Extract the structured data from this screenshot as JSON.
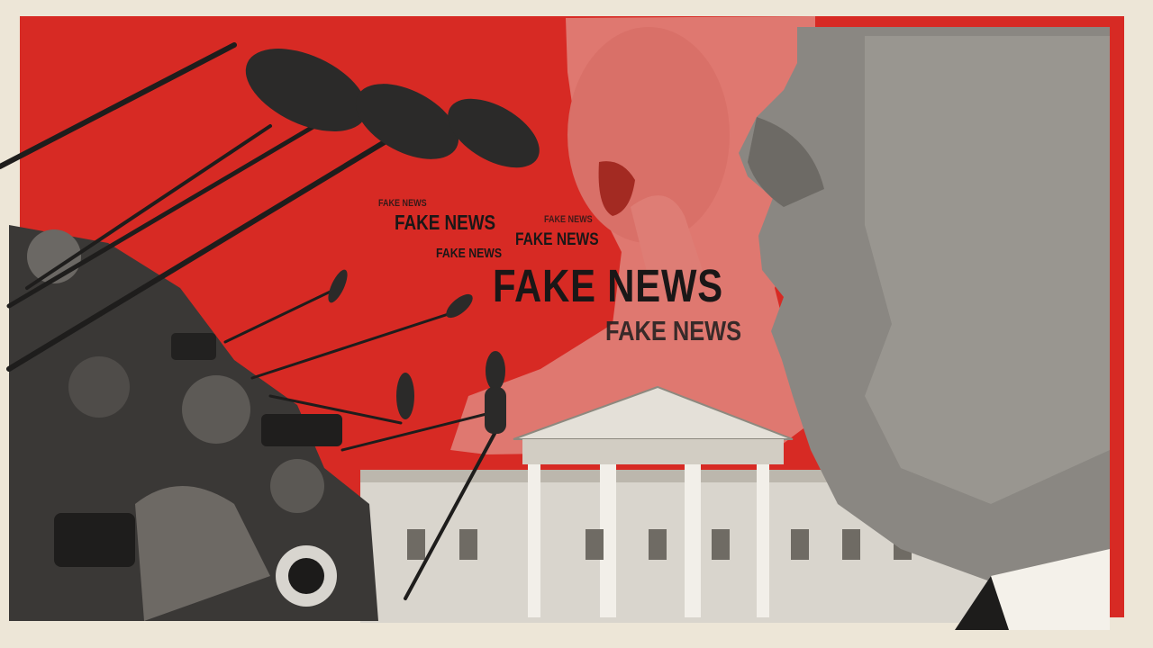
{
  "collage": {
    "overlay_texts": [
      "FAKE NEWS",
      "FAKE NEWS",
      "FAKE NEWS",
      "FAKE NEWS",
      "FAKE NEWS",
      "FAKE NEWS",
      "FAKE NEWS"
    ]
  },
  "colors": {
    "background_red": "#d72a24",
    "paper": "#ede6d7",
    "ink": "#1a1717"
  },
  "icons": {
    "microphones": "boom-microphone-icon",
    "cameras": "camera-icon",
    "building": "white-house-illustration",
    "figure": "man-profile-illustration"
  }
}
